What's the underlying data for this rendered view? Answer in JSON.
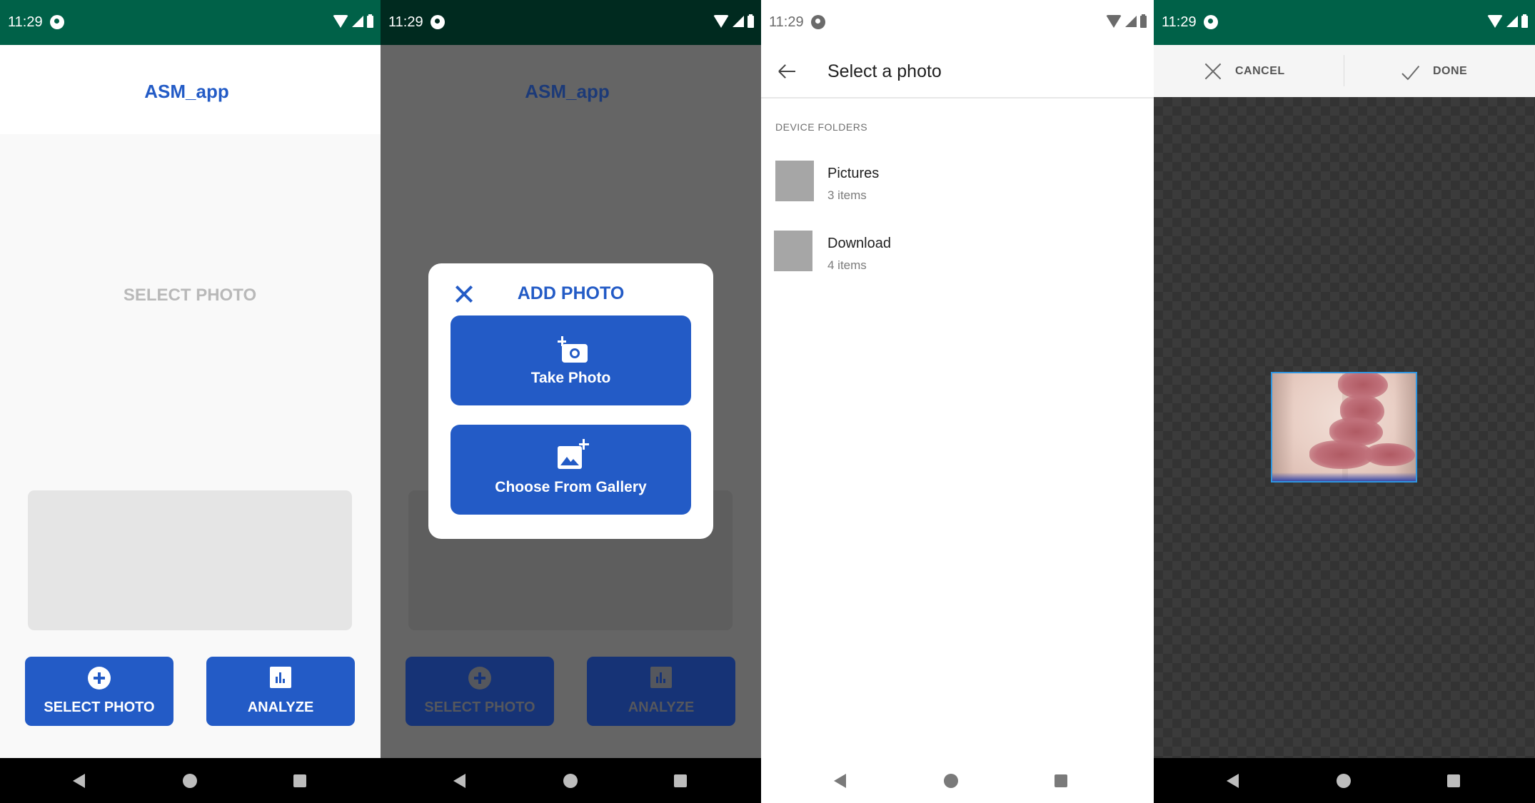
{
  "status_bar": {
    "time": "11:29"
  },
  "screen1": {
    "app_title": "ASM_app",
    "placeholder_text": "SELECT PHOTO",
    "select_button_label": "SELECT PHOTO",
    "analyze_button_label": "ANALYZE"
  },
  "screen2": {
    "app_title": "ASM_app",
    "dialog": {
      "title": "ADD PHOTO",
      "take_photo_label": "Take Photo",
      "gallery_label": "Choose From Gallery"
    },
    "select_button_label": "SELECT PHOTO",
    "analyze_button_label": "ANALYZE"
  },
  "screen3": {
    "title": "Select a photo",
    "section_label": "DEVICE FOLDERS",
    "folders": [
      {
        "name": "Pictures",
        "count": "3 items"
      },
      {
        "name": "Download",
        "count": "4 items"
      }
    ]
  },
  "screen4": {
    "cancel_label": "CANCEL",
    "done_label": "DONE"
  },
  "colors": {
    "status_bar": "#006148",
    "accent": "#235bc6",
    "crop_border": "#2f95e0"
  },
  "icons": {
    "nav": [
      "back-icon",
      "home-icon",
      "recents-icon"
    ],
    "dialog": [
      "close-icon",
      "add-camera-icon",
      "add-photo-icon"
    ],
    "buttons": [
      "add-circle-icon",
      "bar-chart-icon"
    ],
    "crop": [
      "close-icon",
      "check-icon"
    ]
  }
}
